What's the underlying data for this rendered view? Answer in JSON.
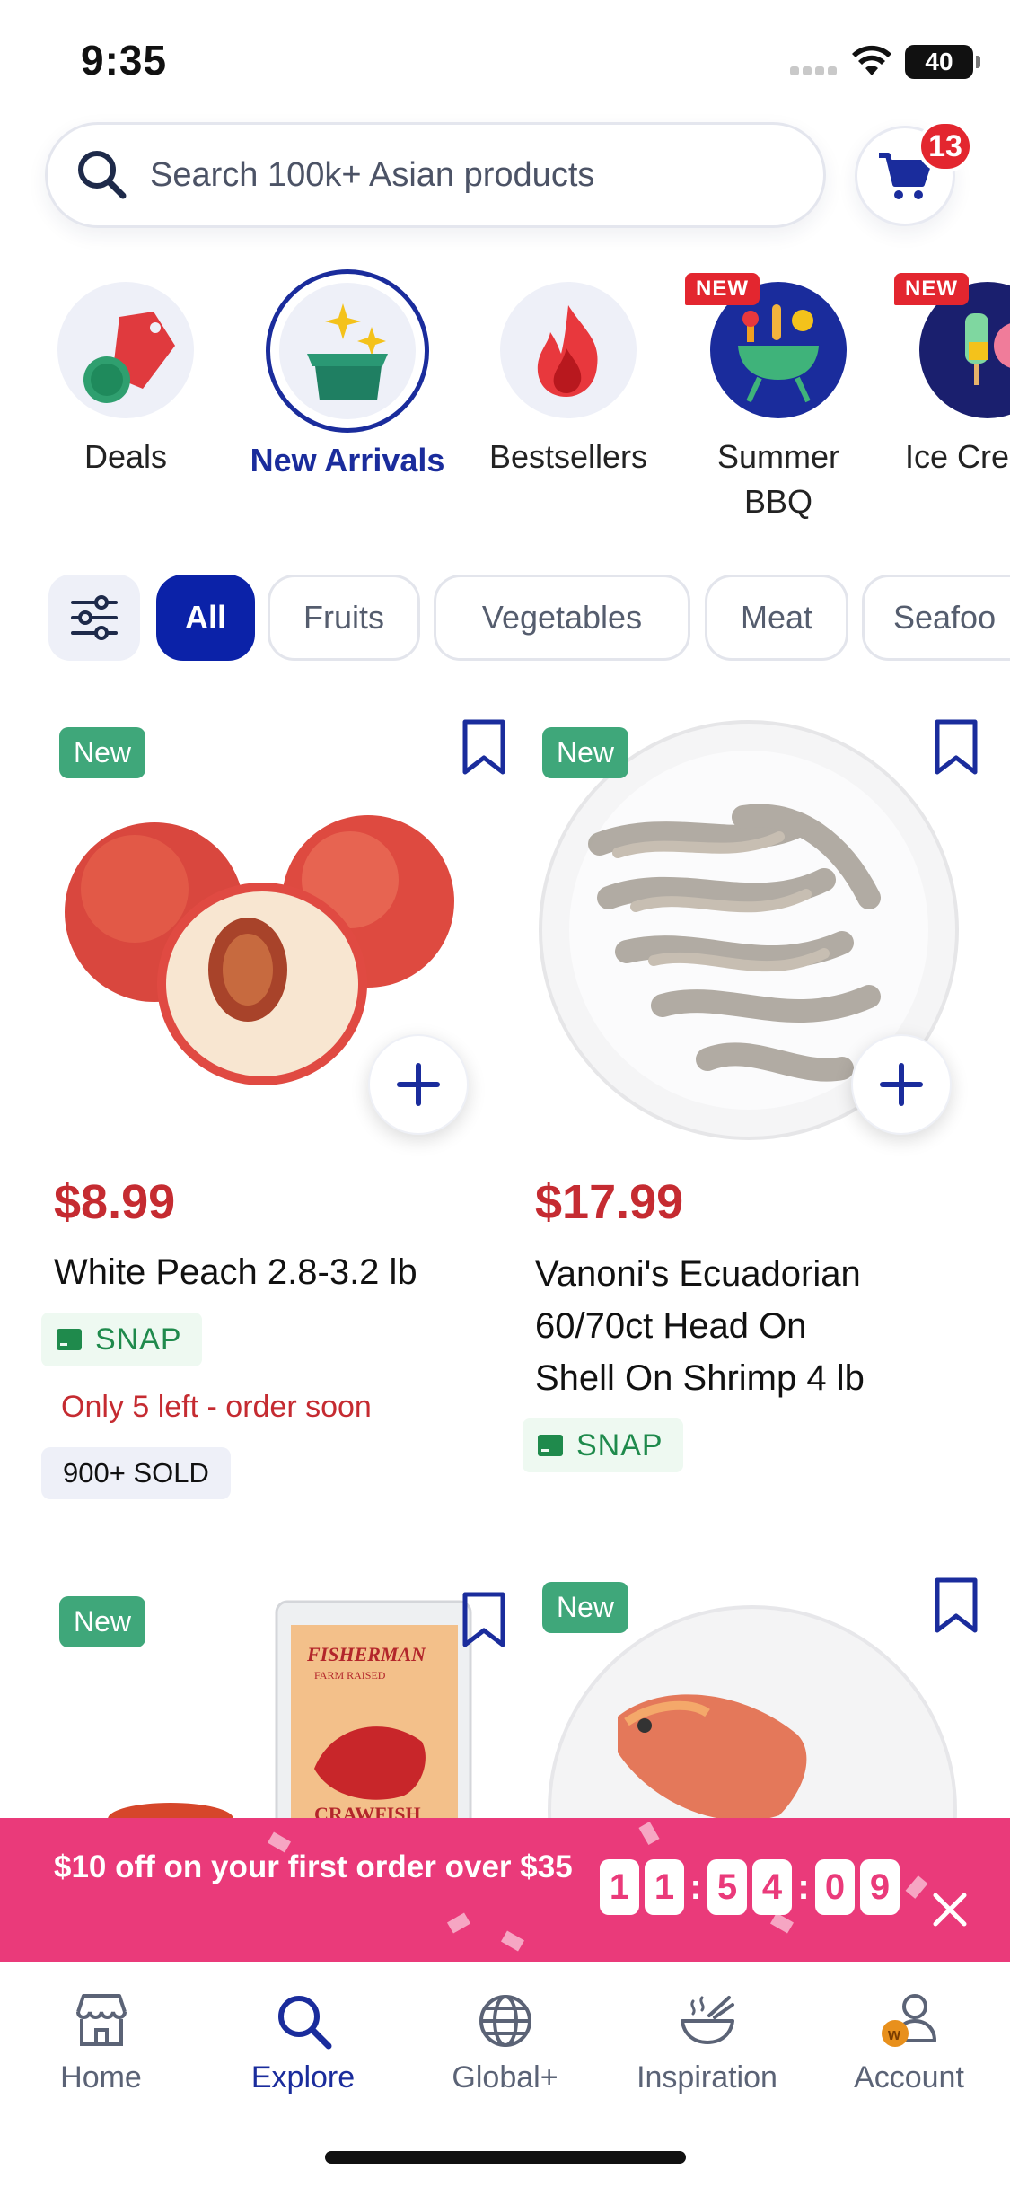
{
  "status_bar": {
    "time": "9:35",
    "battery": "40"
  },
  "search": {
    "placeholder": "Search 100k+ Asian products"
  },
  "cart": {
    "count": "13"
  },
  "categories": [
    {
      "label": "Deals",
      "icon": "price-tag-icon",
      "new": false,
      "active": false
    },
    {
      "label": "New Arrivals",
      "icon": "gift-box-sparkle-icon",
      "new": false,
      "active": true
    },
    {
      "label": "Bestsellers",
      "icon": "flame-icon",
      "new": false,
      "active": false
    },
    {
      "label": "Summer BBQ",
      "label_line1": "Summer",
      "label_line2": "BBQ",
      "icon": "grill-icon",
      "new": true,
      "badge": "NEW",
      "active": false
    },
    {
      "label": "Ice Cre",
      "icon": "ice-cream-icon",
      "new": true,
      "badge": "NEW",
      "active": false
    }
  ],
  "filters": {
    "icon": "sliders-icon",
    "chips": [
      {
        "label": "All",
        "active": true
      },
      {
        "label": "Fruits",
        "active": false
      },
      {
        "label": "Vegetables",
        "active": false
      },
      {
        "label": "Meat",
        "active": false
      },
      {
        "label": "Seafoo",
        "active": false
      }
    ]
  },
  "products": [
    {
      "tag": "New",
      "price": "$8.99",
      "name": "White Peach 2.8-3.2 lb",
      "snap": "SNAP",
      "stock": "Only 5 left - order soon",
      "sold": "900+ SOLD"
    },
    {
      "tag": "New",
      "price": "$17.99",
      "name_line1": "Vanoni's Ecuadorian",
      "name_line2": "60/70ct Head On",
      "name_line3": "Shell On Shrimp 4 lb",
      "snap": "SNAP"
    },
    {
      "tag": "New",
      "package_brand": "FISHERMAN",
      "package_text": "FARM RAISED",
      "package_text2": "CRAWFISH"
    },
    {
      "tag": "New"
    }
  ],
  "promo": {
    "text": "$10 off on your first order over $35",
    "timer": [
      "1",
      "1",
      "5",
      "4",
      "0",
      "9"
    ]
  },
  "tabs": [
    {
      "label": "Home",
      "icon": "store-icon",
      "active": false
    },
    {
      "label": "Explore",
      "icon": "search-icon",
      "active": true
    },
    {
      "label": "Global+",
      "icon": "globe-icon",
      "active": false
    },
    {
      "label": "Inspiration",
      "icon": "bowl-icon",
      "active": false
    },
    {
      "label": "Account",
      "icon": "account-icon",
      "active": false
    }
  ],
  "colors": {
    "brand": "#1a2c9c",
    "chip_active": "#0b22a8",
    "price": "#c52b31",
    "promo": "#ea3a7a",
    "snap": "#1f8a4c",
    "new_tag": "#3fa77a",
    "badge": "#e3262f"
  }
}
